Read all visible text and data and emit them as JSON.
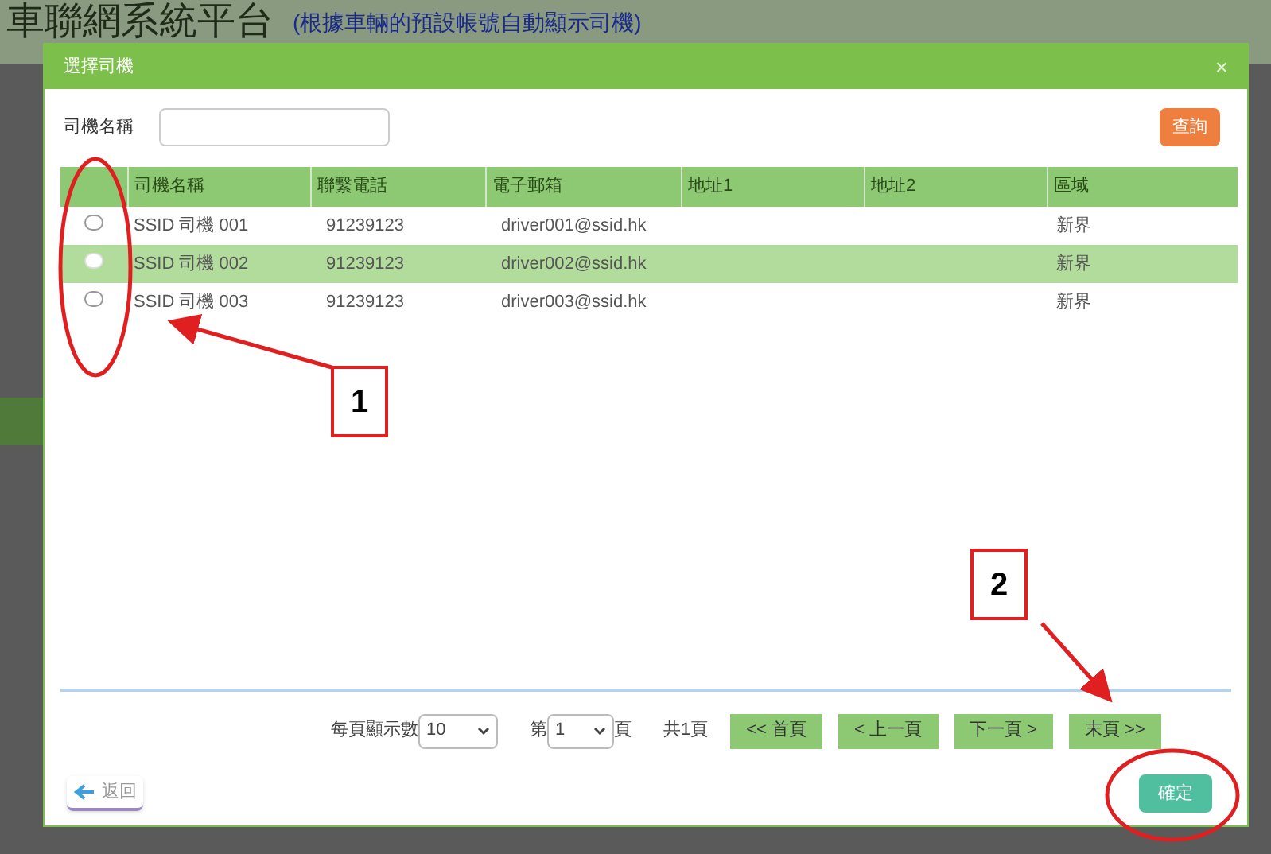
{
  "background_page": {
    "title": "車聯網系統平台",
    "link": "(根據車輛的預設帳號自動顯示司機)"
  },
  "dialog": {
    "title": "選擇司機",
    "close": "×",
    "search": {
      "label": "司機名稱",
      "button": "查詢"
    },
    "table": {
      "columns": [
        "司機名稱",
        "聯繫電話",
        "電子郵箱",
        "地址1",
        "地址2",
        "區域"
      ],
      "rows": [
        {
          "selected": false,
          "cells": [
            "SSID 司機 001",
            "91239123",
            "driver001@ssid.hk",
            "",
            "",
            "新界"
          ]
        },
        {
          "selected": true,
          "cells": [
            "SSID 司機 002",
            "91239123",
            "driver002@ssid.hk",
            "",
            "",
            "新界"
          ]
        },
        {
          "selected": false,
          "cells": [
            "SSID 司機 003",
            "91239123",
            "driver003@ssid.hk",
            "",
            "",
            "新界"
          ]
        }
      ]
    },
    "pagination": {
      "per_page_label": "每頁顯示數",
      "per_page": "10",
      "page_prefix": "第",
      "page": "1",
      "page_suffix": "頁",
      "total": "共1頁",
      "buttons": [
        "<< 首頁",
        "< 上一頁",
        "下一頁 >",
        "末頁 >>"
      ]
    },
    "back": "返回",
    "confirm": "確定"
  },
  "annotations": [
    {
      "label": "1"
    },
    {
      "label": "2"
    }
  ]
}
